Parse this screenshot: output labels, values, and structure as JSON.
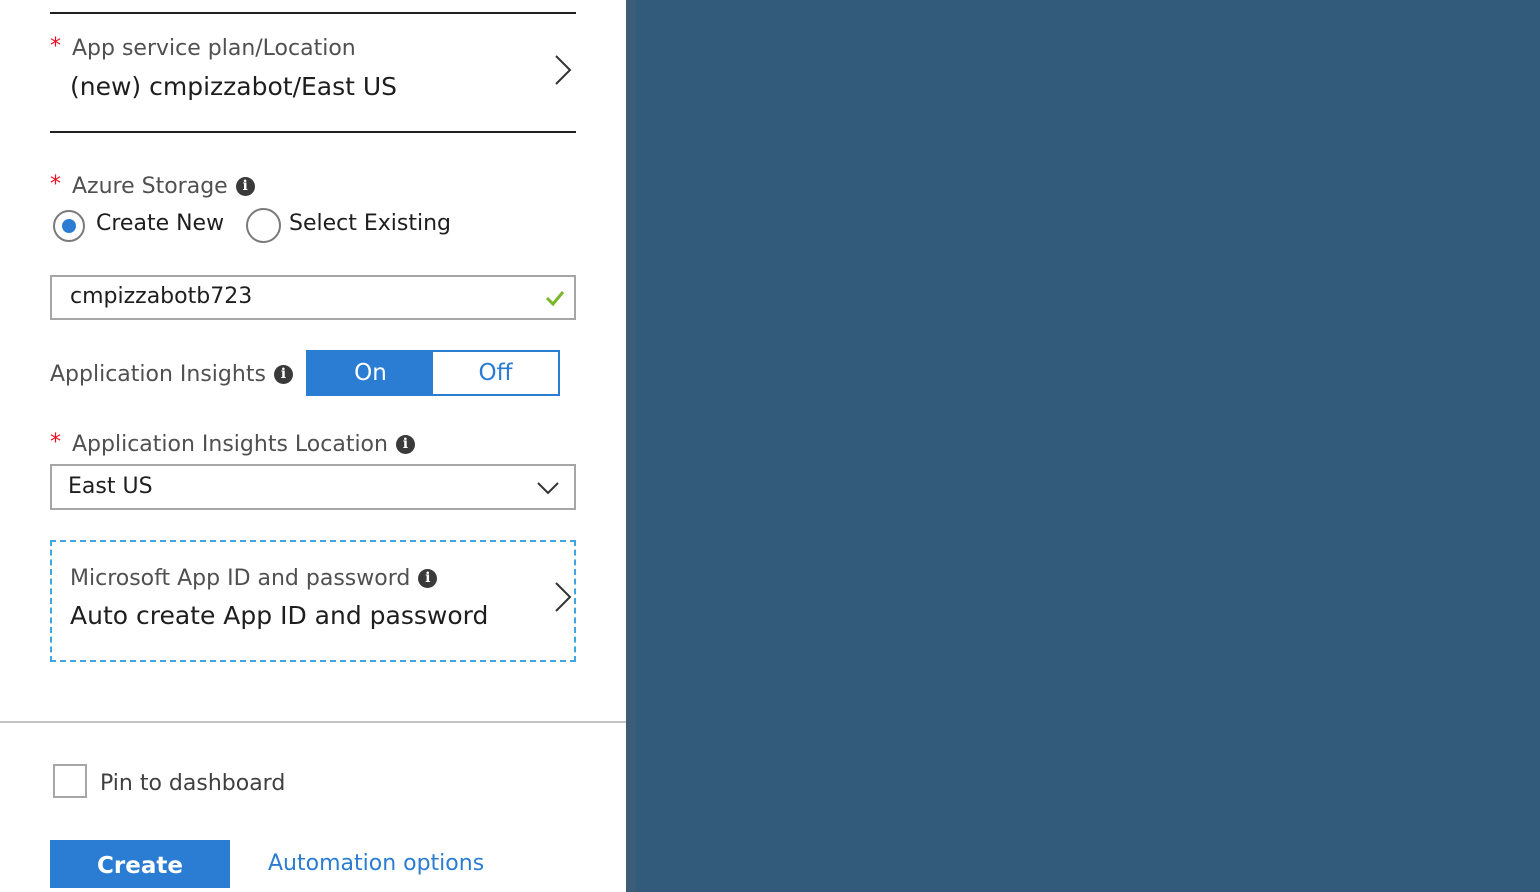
{
  "app_service_plan": {
    "label": "App service plan/Location",
    "value": "(new) cmpizzabot/East US",
    "required_marker": "*"
  },
  "azure_storage": {
    "label": "Azure Storage",
    "required_marker": "*",
    "info_icon": "info-icon",
    "options": [
      {
        "label": "Create New",
        "selected": true
      },
      {
        "label": "Select Existing",
        "selected": false
      }
    ],
    "name_value": "cmpizzabotb723",
    "valid_icon": "checkmark-icon"
  },
  "application_insights": {
    "label": "Application Insights",
    "toggle": {
      "on_label": "On",
      "off_label": "Off",
      "selected": "On"
    }
  },
  "application_insights_location": {
    "label": "Application Insights Location",
    "required_marker": "*",
    "selected": "East US"
  },
  "app_id": {
    "label": "Microsoft App ID and password",
    "value": "Auto create App ID and password"
  },
  "footer": {
    "pin_label": "Pin to dashboard",
    "pin_checked": false,
    "create_label": "Create",
    "automation_label": "Automation options"
  },
  "colors": {
    "accent": "#2b7cd3",
    "required": "#e81123",
    "valid": "#7ab829",
    "backdrop": "#325a7b",
    "focus_border": "#41a6e0"
  }
}
